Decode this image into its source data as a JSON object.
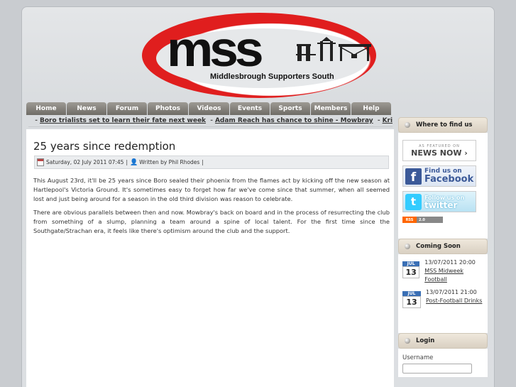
{
  "header": {
    "logo_text": "mss",
    "subtitle": "Middlesbrough Supporters South",
    "colors": {
      "accent": "#e01e1e"
    }
  },
  "nav": [
    {
      "label": "Home"
    },
    {
      "label": "News"
    },
    {
      "label": "Forum"
    },
    {
      "label": "Photos"
    },
    {
      "label": "Videos"
    },
    {
      "label": "Events"
    },
    {
      "label": "Sports"
    },
    {
      "label": "Members"
    },
    {
      "label": "Help"
    }
  ],
  "ticker": {
    "items": [
      "Boro trialists set to learn their fate next week",
      "Adam Reach has chance to shine - Mowbray",
      "Kris Boyd completes mov"
    ]
  },
  "article": {
    "title": "25 years since redemption",
    "date": "Saturday, 02 July 2011 07:45",
    "sep1": "|",
    "author": "Written by Phil Rhodes",
    "sep2": "|",
    "paragraphs": [
      "This August 23rd, it'll be 25 years since Boro sealed their phoenix from the flames act by kicking off the new season at Hartlepool's Victoria Ground.  It's sometimes easy to forget how far we've come since that summer, when all seemed lost and just being around for a season in the old third division was reason to celebrate.",
      "There are obvious parallels between then and now. Mowbray's back on board and in the process of resurrecting the club from something of a slump, planning a team around a spine of local talent. For the first time since the Southgate/Strachan era, it feels like there's optimism around the club and the support."
    ]
  },
  "sidebar": {
    "find_us": {
      "title": "Where to find us",
      "newsnow_small": "AS FEATURED ON",
      "newsnow_big": "NEWS NOW ›",
      "facebook_line1": "Find us on",
      "facebook_line2": "Facebook",
      "twitter_line1": "Follow us on",
      "twitter_line2": "twitter",
      "rss_a": "RSS",
      "rss_b": "2.0"
    },
    "coming_soon": {
      "title": "Coming Soon",
      "events": [
        {
          "month": "JUL",
          "day": "13",
          "datetime": "13/07/2011 20:00",
          "name": "MSS Midweek Football"
        },
        {
          "month": "JUL",
          "day": "13",
          "datetime": "13/07/2011 21:00",
          "name": "Post-Football Drinks"
        }
      ]
    },
    "login": {
      "title": "Login",
      "username_label": "Username"
    }
  }
}
